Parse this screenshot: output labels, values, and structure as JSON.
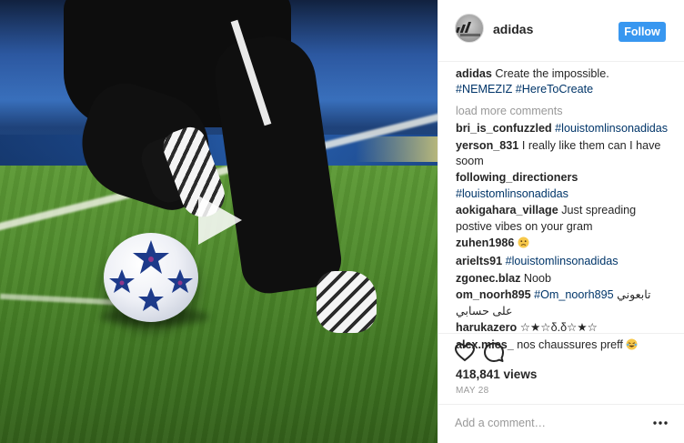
{
  "post": {
    "username": "adidas",
    "follow_label": "Follow",
    "caption_user": "adidas",
    "caption_text": "Create the impossible.",
    "caption_tags": "#NEMEZIZ #HereToCreate",
    "load_more_label": "load more comments"
  },
  "comments": [
    {
      "user": "bri_is_confuzzled",
      "text": "",
      "tag": "#louistomlinsonadidas"
    },
    {
      "user": "yerson_831",
      "text": "I really like them can I have soom",
      "tag": ""
    },
    {
      "user": "following_directioners",
      "text": "",
      "tag": "#louistomlinsonadidas"
    },
    {
      "user": "aokigahara_village",
      "text": "Just spreading postive vibes on your gram",
      "tag": ""
    },
    {
      "user": "zuhen1986",
      "text": "",
      "tag": "",
      "emoji": "worried-face"
    },
    {
      "user": "arielts91",
      "text": "",
      "tag": "#louistomlinsonadidas"
    },
    {
      "user": "zgonec.blaz",
      "text": "Noob",
      "tag": ""
    },
    {
      "user": "om_noorh895",
      "text": "تابعوني على",
      "tag": "#Om_noorh895",
      "text2": "حسابي"
    },
    {
      "user": "harukazero",
      "text": "☆★☆δ.δ☆★☆",
      "tag": ""
    },
    {
      "user": "alex.mies_",
      "text": "nos chaussures preff",
      "tag": "",
      "emoji": "crying-laughing-face"
    }
  ],
  "stats": {
    "views": "418,841 views",
    "date": "MAY 28"
  },
  "add_comment": {
    "placeholder": "Add a comment…"
  },
  "icons": {
    "play": "play-icon",
    "like": "heart-icon",
    "comment": "speech-bubble-icon",
    "more": "more-options-icon"
  },
  "colors": {
    "follow_button": "#3897f0",
    "hashtag": "#003569",
    "muted": "#999999"
  }
}
